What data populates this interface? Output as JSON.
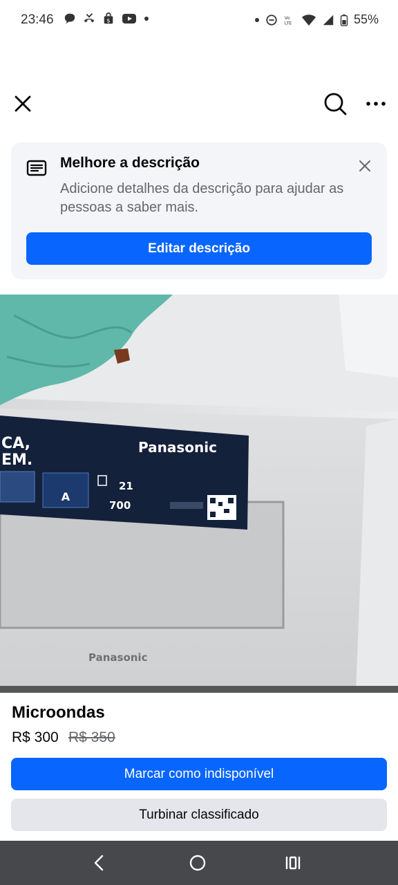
{
  "status_bar": {
    "time": "23:46",
    "battery": "55%",
    "icons_left": [
      "chat-bubble-icon",
      "missed-call-icon",
      "shopping-bag-icon",
      "youtube-icon",
      "dot-icon"
    ],
    "icons_right": [
      "dot-icon",
      "do-not-disturb-icon",
      "volte-icon",
      "wifi-icon",
      "signal-icon",
      "battery-icon"
    ]
  },
  "topbar": {
    "icons": [
      "close-icon",
      "search-icon",
      "more-icon"
    ]
  },
  "description_card": {
    "title": "Melhore a descrição",
    "description": "Adicione detalhes da descrição para ajudar as pessoas a saber mais.",
    "button_label": "Editar descrição"
  },
  "photo": {
    "brand_box": "Panasonic",
    "brand_front": "Panasonic",
    "box_text_left": "CA,\nEM.",
    "energy_rating": "A",
    "capacity": "21",
    "power": "700"
  },
  "listing": {
    "title": "Microondas",
    "price": "R$ 300",
    "original_price": "R$ 350"
  },
  "actions": {
    "mark_unavailable": "Marcar como indisponível",
    "boost_listing": "Turbinar classificado"
  },
  "colors": {
    "accent": "#0866ff",
    "secondary_button": "#e4e6eb",
    "card_background": "#f3f5f8",
    "nav_bar": "#46484b"
  }
}
